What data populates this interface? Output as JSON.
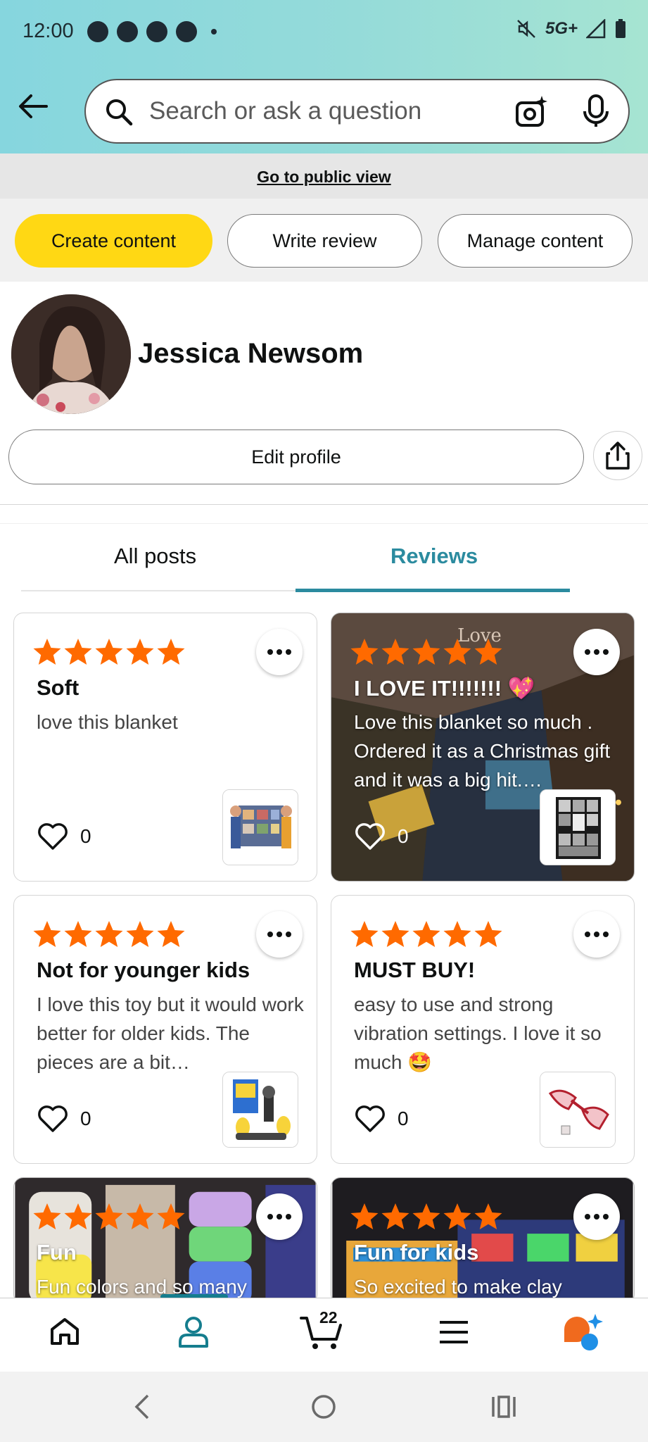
{
  "status_bar": {
    "time": "12:00",
    "network": "5G+"
  },
  "search": {
    "placeholder": "Search or ask a question"
  },
  "public_view": {
    "label": "Go to public view"
  },
  "actions": {
    "create": "Create content",
    "write_review": "Write review",
    "manage": "Manage content"
  },
  "profile": {
    "name": "Jessica Newsom",
    "edit_label": "Edit profile"
  },
  "tabs": [
    {
      "label": "All posts",
      "active": false
    },
    {
      "label": "Reviews",
      "active": true
    }
  ],
  "reviews": [
    {
      "title": "Soft",
      "body": "love this blanket",
      "likes": "0",
      "rating": 5
    },
    {
      "title": "I LOVE IT!!!!!!! 💖",
      "body": "Love this blanket so much . Ordered it as a Christmas gift and it was a big hit.…",
      "likes": "0",
      "rating": 5,
      "overlay_text": "Love"
    },
    {
      "title": "Not for younger kids",
      "body": "I love this toy but it would work better for older kids. The pieces are a bit…",
      "likes": "0",
      "rating": 5
    },
    {
      "title": "MUST BUY!",
      "body": "easy to use and strong vibration settings. I love it so much 🤩",
      "likes": "0",
      "rating": 5
    },
    {
      "title": "Fun",
      "body": "Fun colors and so many",
      "rating": 5
    },
    {
      "title": "Fun for kids",
      "body": "So excited to make clay",
      "rating": 5
    }
  ],
  "bottom_nav": {
    "cart_count": "22",
    "items": [
      "home-icon",
      "profile-icon",
      "cart-icon",
      "menu-icon",
      "rufus-icon"
    ]
  },
  "colors": {
    "accent": "#2b8b9f",
    "star": "#ff6a00",
    "primary_button": "#ffd814"
  }
}
